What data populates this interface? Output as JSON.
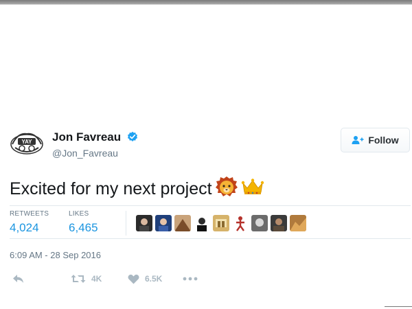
{
  "author": {
    "name": "Jon Favreau",
    "handle": "@Jon_Favreau",
    "verified": true
  },
  "follow_button": {
    "label": "Follow",
    "icon": "add-user-icon"
  },
  "tweet": {
    "text": "Excited for my next project",
    "emojis": [
      "lion-face",
      "crown"
    ]
  },
  "stats": {
    "retweets_label": "RETWEETS",
    "retweets_value": "4,024",
    "likes_label": "LIKES",
    "likes_value": "6,465"
  },
  "likers": [
    "liker-1",
    "liker-2",
    "liker-3",
    "liker-4",
    "liker-5",
    "liker-6",
    "liker-7",
    "liker-8",
    "liker-9"
  ],
  "timestamp": "6:09 AM - 28 Sep 2016",
  "actions": {
    "reply_icon": "reply-icon",
    "retweet_icon": "retweet-icon",
    "retweet_count": "4K",
    "like_icon": "heart-icon",
    "like_count": "6.5K",
    "more_icon": "more-icon"
  },
  "colors": {
    "link_blue": "#1b95e0",
    "muted": "#657786",
    "action_gray": "#aab8c2",
    "verified_blue": "#1da1f2"
  }
}
